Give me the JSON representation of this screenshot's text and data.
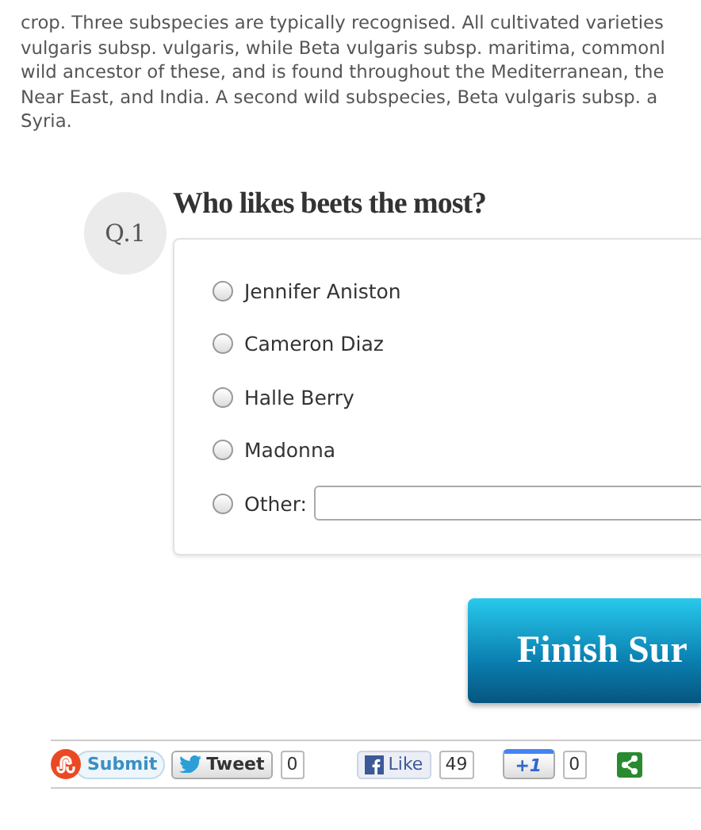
{
  "article": {
    "lines": [
      "crop. Three subspecies are typically recognised. All cultivated varieties",
      "vulgaris subsp. vulgaris, while Beta vulgaris subsp. maritima, commonl",
      "wild ancestor of these, and is found throughout the Mediterranean, the",
      "Near East, and India. A second wild subspecies, Beta vulgaris subsp. a",
      "Syria."
    ]
  },
  "question": {
    "number": "Q.1",
    "title": "Who likes beets the most?",
    "options": [
      {
        "kind": "radio",
        "label": "Jennifer Aniston",
        "selected": false
      },
      {
        "kind": "radio",
        "label": "Cameron Diaz",
        "selected": false
      },
      {
        "kind": "radio",
        "label": "Halle Berry",
        "selected": false
      },
      {
        "kind": "radio",
        "label": "Madonna",
        "selected": false
      },
      {
        "kind": "other",
        "label": "Other:",
        "selected": false
      }
    ]
  },
  "finish_button": {
    "label": "Finish Sur"
  },
  "share_bar": [
    {
      "kind": "stumble",
      "label": "Submit"
    },
    {
      "kind": "tweet",
      "label": "Tweet",
      "count": "0"
    },
    {
      "kind": "like",
      "label": "Like",
      "count": "49"
    },
    {
      "kind": "plusone",
      "label": "+1",
      "count": "0"
    },
    {
      "kind": "share"
    }
  ]
}
